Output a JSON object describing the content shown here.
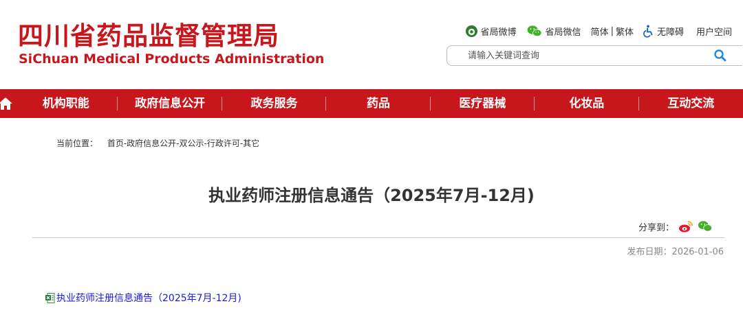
{
  "header": {
    "logo_cn": "四川省药品监督管理局",
    "logo_en": "SiChuan Medical Products Administration",
    "links": {
      "weibo": "省局微博",
      "wechat": "省局微信",
      "simplified": "简体",
      "separator": "|",
      "traditional": "繁体",
      "accessible": "无障碍",
      "user_space": "用户空间"
    },
    "search_placeholder": "请输入关键词查询"
  },
  "nav": {
    "items": [
      "机构职能",
      "政府信息公开",
      "政务服务",
      "药品",
      "医疗器械",
      "化妆品",
      "互动交流"
    ]
  },
  "breadcrumb": {
    "label": "当前位置：",
    "path": "首页-政府信息公开-双公示-行政许可-其它"
  },
  "article": {
    "title": "执业药师注册信息通告（2025年7月-12月)",
    "share_label": "分享到：",
    "publish_date": "发布日期：2026-01-06",
    "attachment": "执业药师注册信息通告（2025年7月-12月)"
  },
  "colors": {
    "brand_red": "#c8161d",
    "link_blue": "#1a1ae0"
  }
}
